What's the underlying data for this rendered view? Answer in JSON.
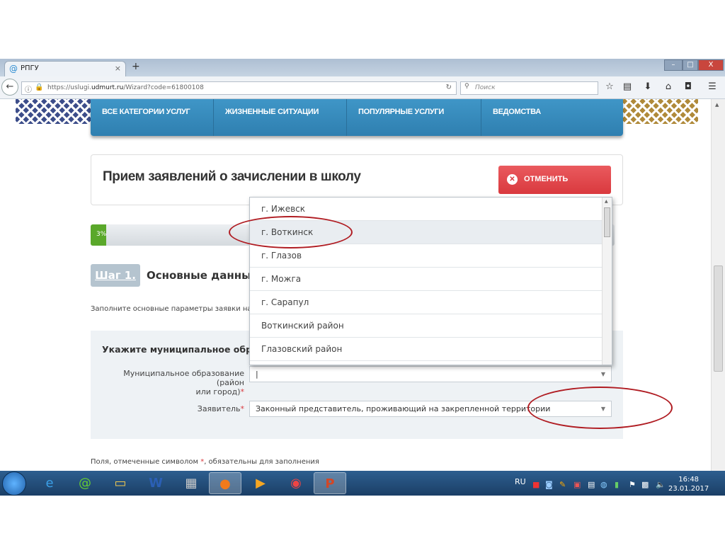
{
  "browser": {
    "tab_title": "РПГУ",
    "url_prefix": "https://uslugi.",
    "url_domain": "udmurt.ru",
    "url_path": "/Wizard?code=61800108",
    "search_placeholder": "Поиск"
  },
  "nav": {
    "items": [
      "ВСЕ КАТЕГОРИИ УСЛУГ",
      "ЖИЗНЕННЫЕ СИТУАЦИИ",
      "ПОПУЛЯРНЫЕ УСЛУГИ",
      "ВЕДОМСТВА"
    ]
  },
  "page": {
    "title": "Прием заявлений о зачислении в школу",
    "cancel_label": "ОТМЕНИТЬ",
    "progress_label": "3%",
    "progress_percent": 3,
    "step_badge": "Шаг 1.",
    "step_title": "Основные данные",
    "instruction": "Заполните основные параметры заявки на",
    "panel_title": "Укажите муниципальное образование",
    "muni_label_1": "Муниципальное образование (район",
    "muni_label_2": "или город)",
    "required_mark": "*",
    "muni_value": "|",
    "applicant_label": "Заявитель",
    "applicant_value": "Законный представитель, проживающий на закрепленной территории",
    "footnote_1": "Поля, отмеченные символом ",
    "footnote_2": ", обязательны для заполнения"
  },
  "dropdown": {
    "options": [
      "г. Ижевск",
      "г. Воткинск",
      "г. Глазов",
      "г. Можга",
      "г. Сарапул",
      "Воткинский район",
      "Глазовский район"
    ],
    "highlighted": "г. Воткинск"
  },
  "taskbar": {
    "lang": "RU",
    "time": "16:48",
    "date": "23.01.2017"
  },
  "colors": {
    "nav": "#3a8fc0",
    "cancel": "#e0474c",
    "progress": "#5aa82a",
    "annotation": "#b01c22"
  }
}
